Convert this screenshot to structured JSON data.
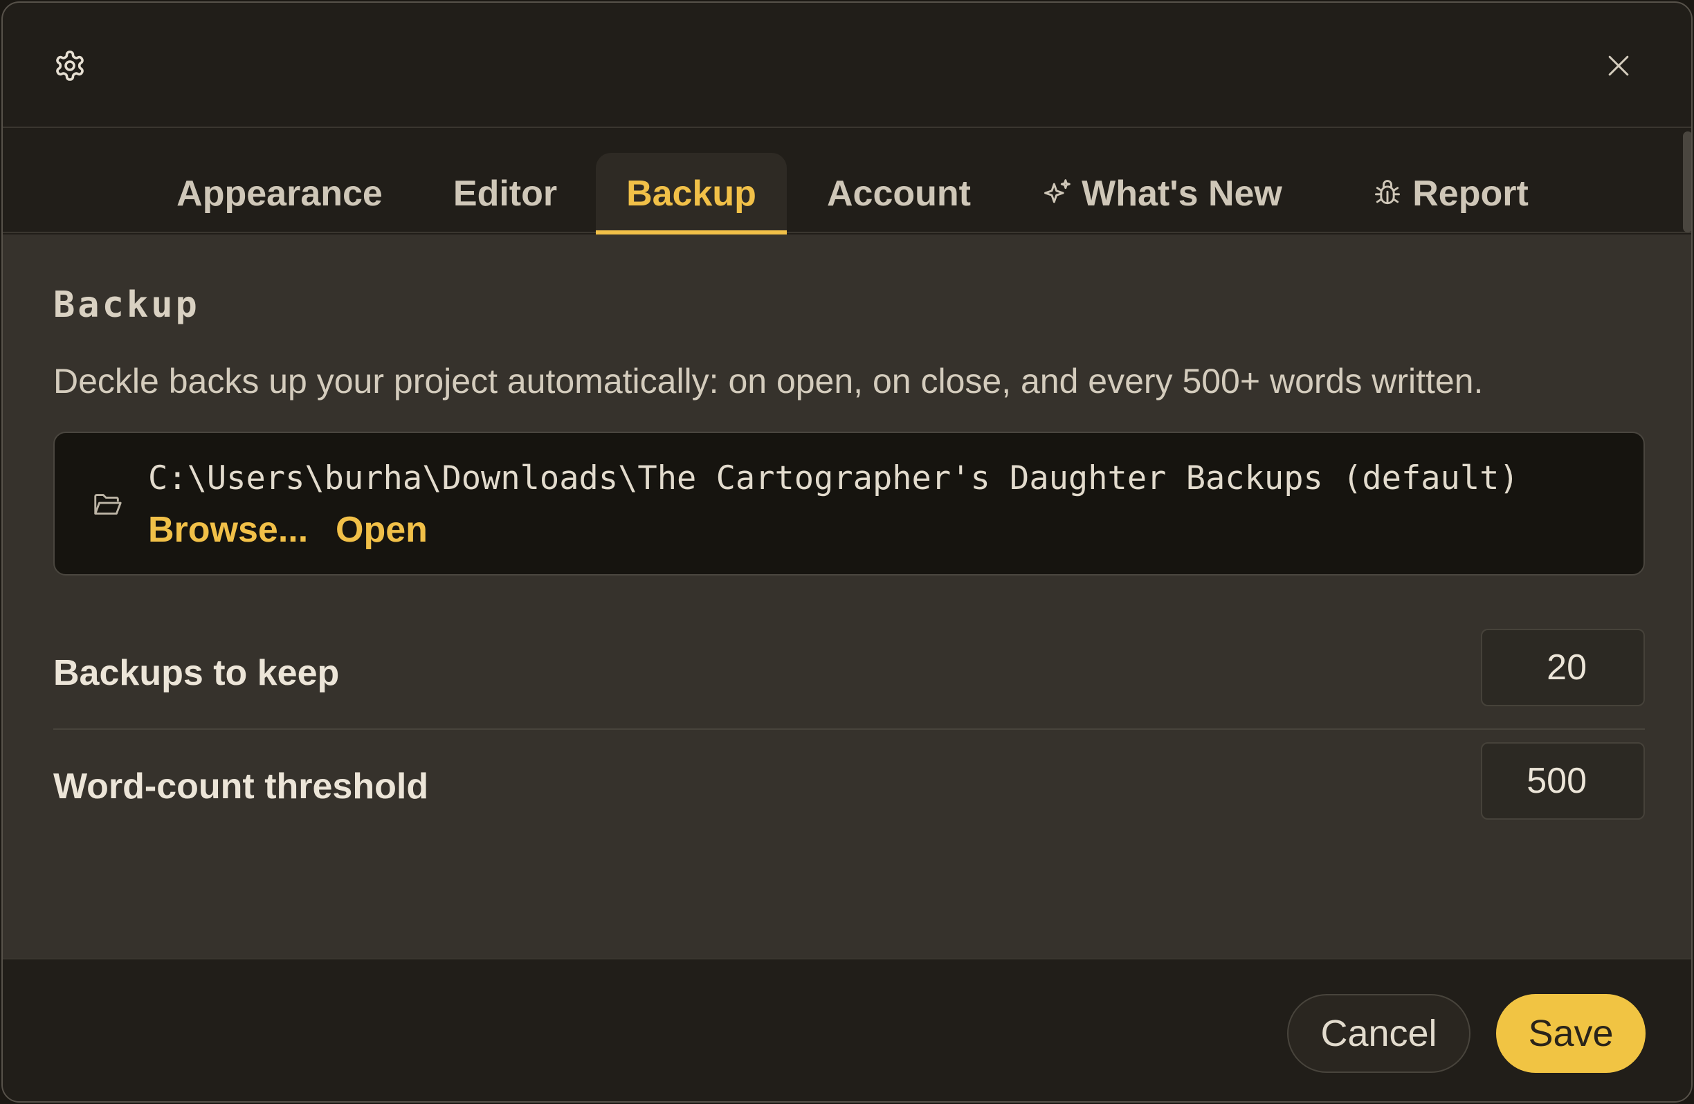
{
  "dialog": {
    "header": {
      "icon": "gear-icon",
      "close_icon": "close-icon"
    },
    "tabs": [
      {
        "label": "Appearance",
        "active": false
      },
      {
        "label": "Editor",
        "active": false
      },
      {
        "label": "Backup",
        "active": true
      },
      {
        "label": "Account",
        "active": false
      },
      {
        "label": "What's New",
        "icon": "sparkle-icon",
        "active": false
      },
      {
        "label": "Report",
        "icon": "bug-icon",
        "active": false
      }
    ],
    "backup": {
      "title": "Backup",
      "description": "Deckle backs up your project automatically: on open, on close, and every 500+ words written.",
      "location": {
        "icon": "folder-icon",
        "path": "C:\\Users\\burha\\Downloads\\The Cartographer's Daughter Backups (default)",
        "browse_label": "Browse...",
        "open_label": "Open"
      },
      "settings": [
        {
          "label": "Backups to keep",
          "value": "20"
        },
        {
          "label": "Word-count threshold",
          "value": "500"
        }
      ]
    },
    "footer": {
      "cancel_label": "Cancel",
      "save_label": "Save"
    }
  },
  "colors": {
    "accent": "#f1c048",
    "dialog_bg": "#211e19",
    "content_bg": "#36322c",
    "path_bg": "#16140f"
  }
}
